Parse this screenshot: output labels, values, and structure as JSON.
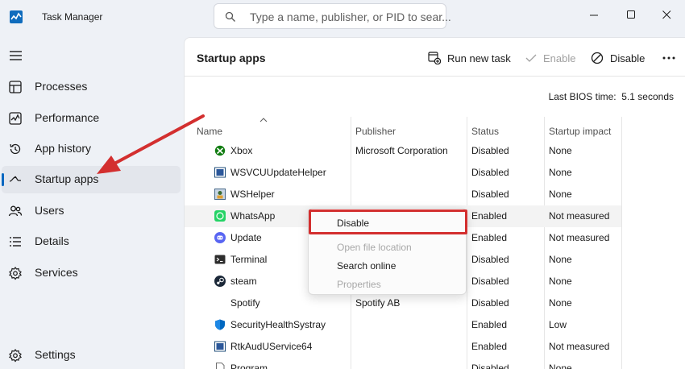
{
  "app": {
    "title": "Task Manager"
  },
  "search": {
    "placeholder": "Type a name, publisher, or PID to sear..."
  },
  "sidebar": {
    "items": [
      {
        "label": "Processes",
        "icon": "processes-icon"
      },
      {
        "label": "Performance",
        "icon": "performance-icon"
      },
      {
        "label": "App history",
        "icon": "history-icon"
      },
      {
        "label": "Startup apps",
        "icon": "startup-icon",
        "active": true
      },
      {
        "label": "Users",
        "icon": "users-icon"
      },
      {
        "label": "Details",
        "icon": "details-icon"
      },
      {
        "label": "Services",
        "icon": "services-icon"
      }
    ],
    "settings_label": "Settings"
  },
  "main": {
    "title": "Startup apps",
    "toolbar": {
      "run_new_task": "Run new task",
      "enable": "Enable",
      "disable": "Disable"
    },
    "bios_label": "Last BIOS time:",
    "bios_value": "5.1 seconds"
  },
  "table": {
    "columns": [
      "Name",
      "Publisher",
      "Status",
      "Startup impact"
    ],
    "rows": [
      {
        "name": "Xbox",
        "publisher": "Microsoft Corporation",
        "status": "Disabled",
        "impact": "None",
        "icon": "xbox-icon"
      },
      {
        "name": "WSVCUUpdateHelper",
        "publisher": "",
        "status": "Disabled",
        "impact": "None",
        "icon": "app-window-icon"
      },
      {
        "name": "WSHelper",
        "publisher": "",
        "status": "Disabled",
        "impact": "None",
        "icon": "wshelper-icon"
      },
      {
        "name": "WhatsApp",
        "publisher": "",
        "status": "Enabled",
        "impact": "Not measured",
        "icon": "whatsapp-icon"
      },
      {
        "name": "Update",
        "publisher": "",
        "status": "Enabled",
        "impact": "Not measured",
        "icon": "discord-icon"
      },
      {
        "name": "Terminal",
        "publisher": "",
        "status": "Disabled",
        "impact": "None",
        "icon": "terminal-icon"
      },
      {
        "name": "steam",
        "publisher": "",
        "status": "Disabled",
        "impact": "None",
        "icon": "steam-icon"
      },
      {
        "name": "Spotify",
        "publisher": "Spotify AB",
        "status": "Disabled",
        "impact": "None",
        "icon": ""
      },
      {
        "name": "SecurityHealthSystray",
        "publisher": "",
        "status": "Enabled",
        "impact": "Low",
        "icon": "shield-icon"
      },
      {
        "name": "RtkAudUService64",
        "publisher": "",
        "status": "Enabled",
        "impact": "Not measured",
        "icon": "app-window-icon"
      },
      {
        "name": "Program",
        "publisher": "",
        "status": "Disabled",
        "impact": "None",
        "icon": "file-icon"
      }
    ]
  },
  "context_menu": {
    "items": [
      {
        "label": "Disable",
        "enabled": true
      },
      {
        "label": "Open file location",
        "enabled": false
      },
      {
        "label": "Search online",
        "enabled": true
      },
      {
        "label": "Properties",
        "enabled": false
      }
    ]
  },
  "colors": {
    "accent": "#0067c0",
    "annotation": "#d32f2f",
    "sidebar_bg": "#eef1f6"
  }
}
